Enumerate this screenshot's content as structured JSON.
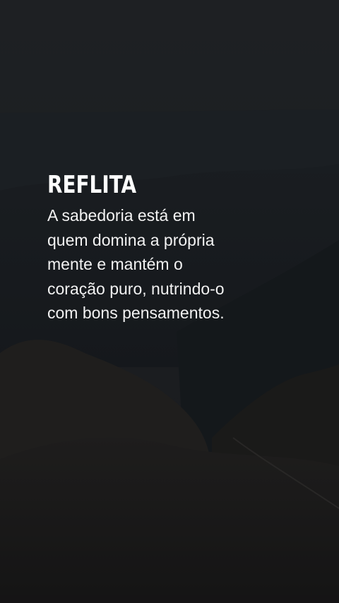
{
  "heading": "REFLITA",
  "body_lines": [
    "A sabedoria está em",
    "quem domina a própria",
    "mente e mantém o",
    "coração puro, nutrindo-o",
    "com bons pensamentos."
  ],
  "colors": {
    "text": "#ffffff",
    "background": "#1e2023"
  }
}
